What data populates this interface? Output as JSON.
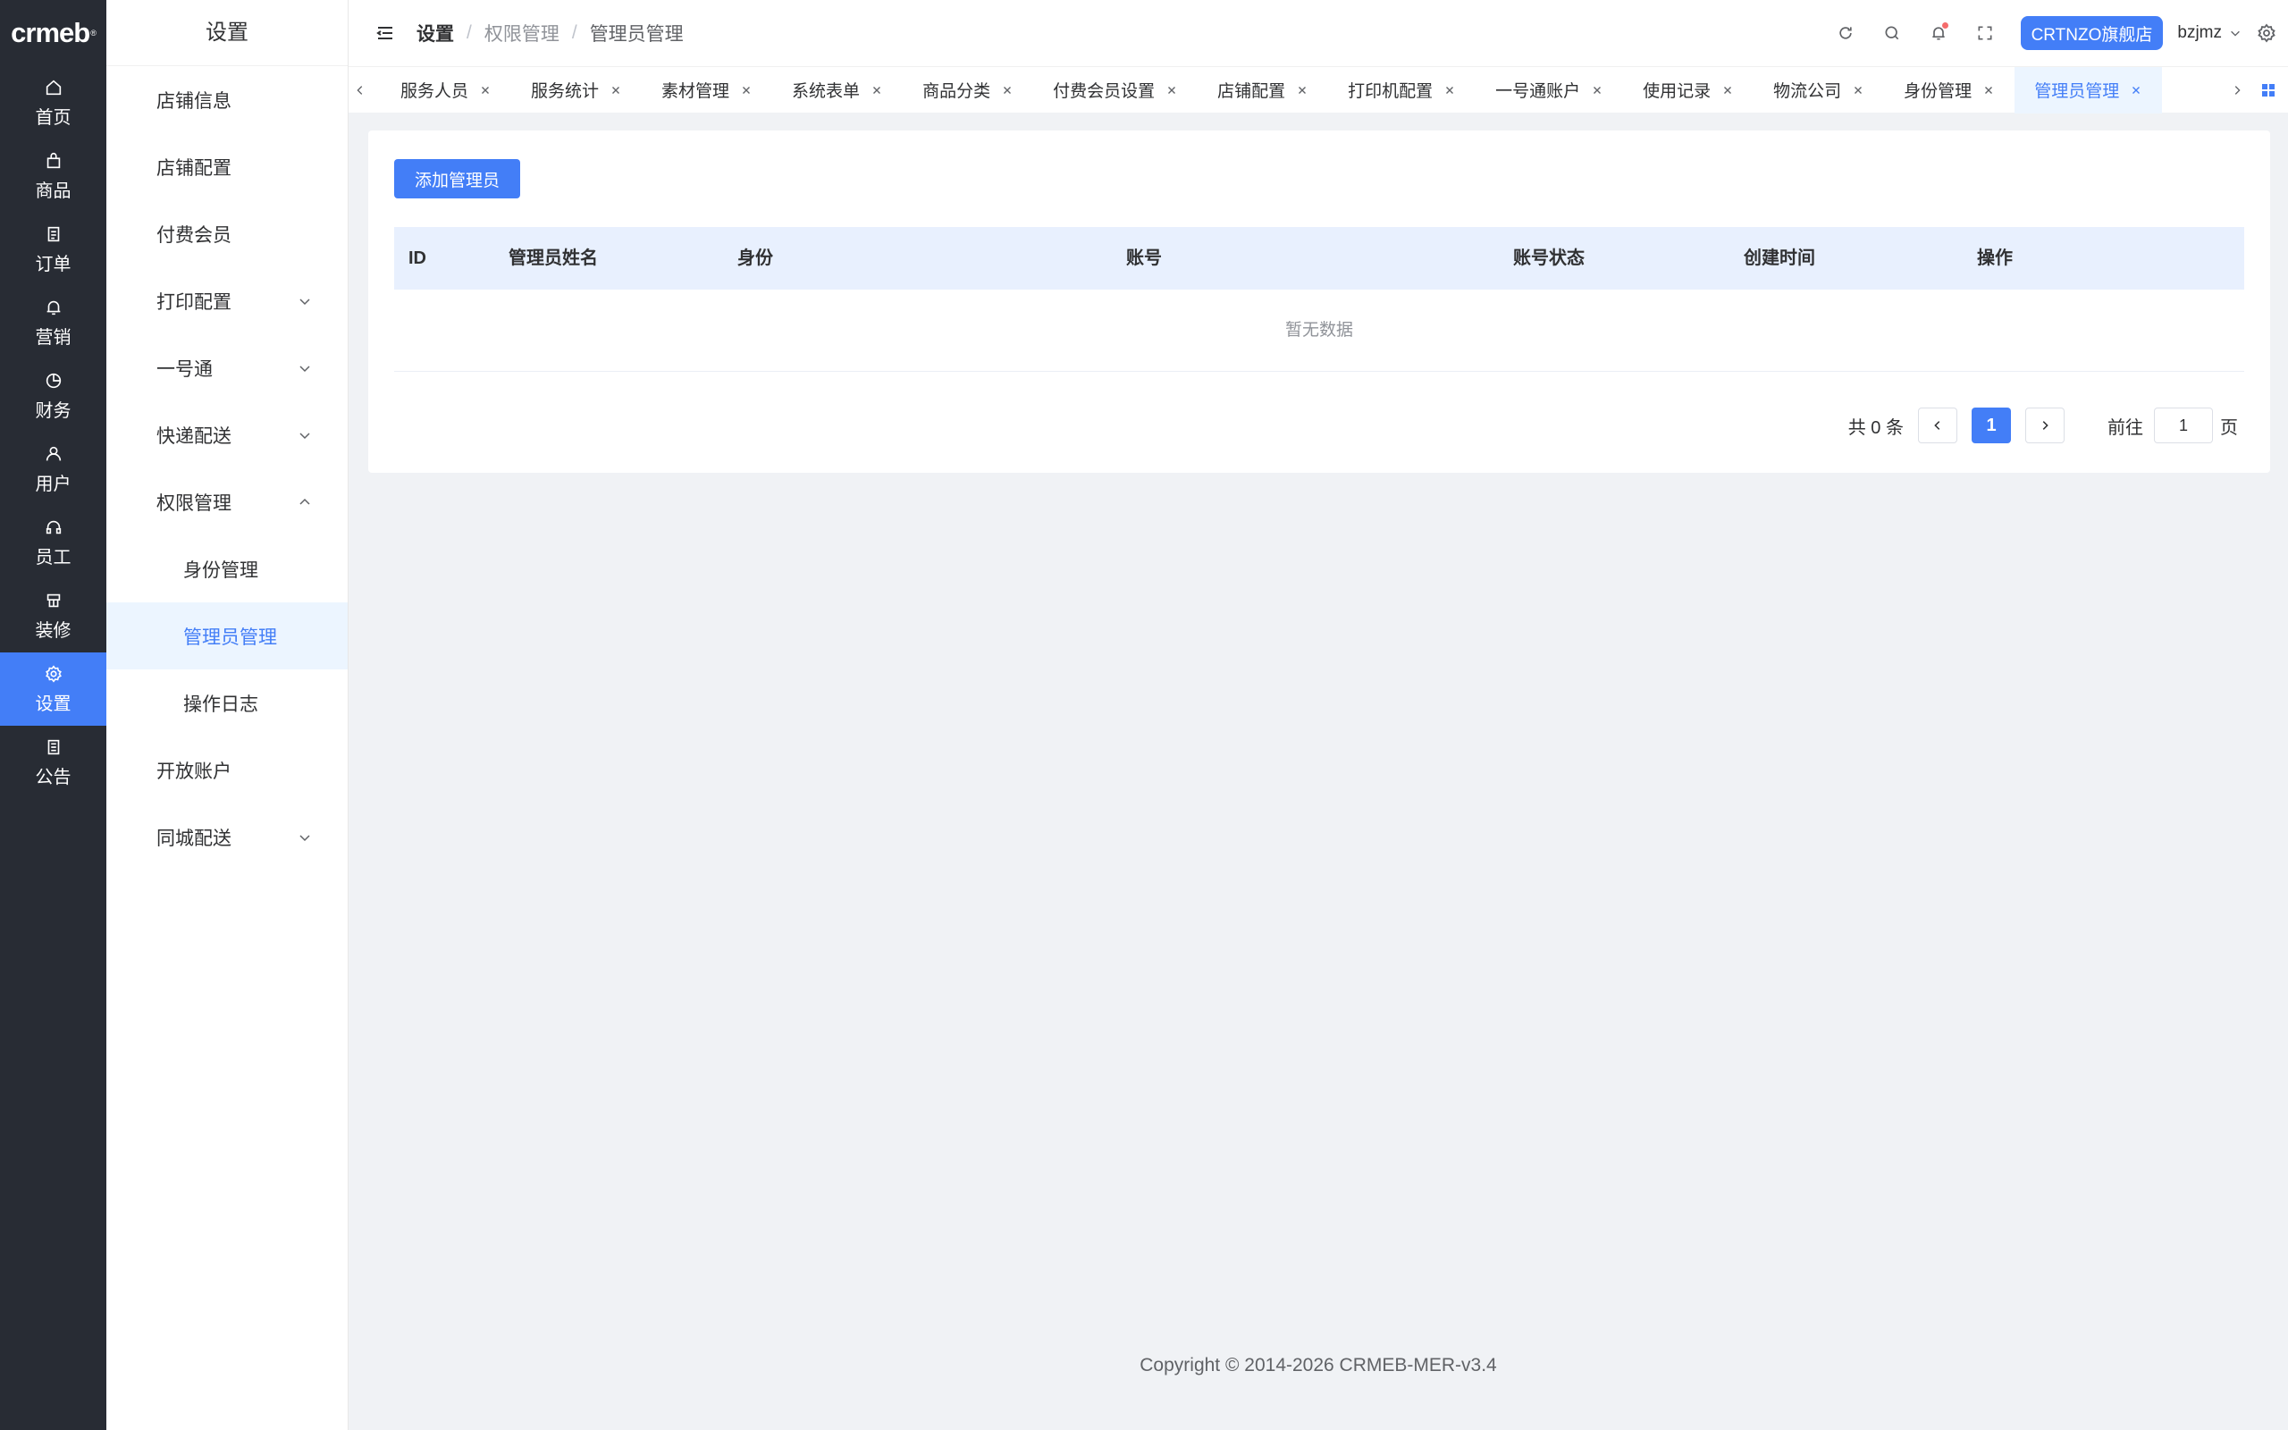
{
  "brand": {
    "logo_text": "crmeb",
    "logo_mark": "®"
  },
  "rail": [
    {
      "label": "首页",
      "icon": "home-icon"
    },
    {
      "label": "商品",
      "icon": "bag-icon"
    },
    {
      "label": "订单",
      "icon": "order-icon"
    },
    {
      "label": "营销",
      "icon": "bell-icon"
    },
    {
      "label": "财务",
      "icon": "pie-icon"
    },
    {
      "label": "用户",
      "icon": "user-icon"
    },
    {
      "label": "员工",
      "icon": "headset-icon"
    },
    {
      "label": "装修",
      "icon": "decorate-icon"
    },
    {
      "label": "设置",
      "icon": "settings-icon",
      "active": true
    },
    {
      "label": "公告",
      "icon": "notice-icon"
    }
  ],
  "submenu": {
    "title": "设置",
    "items": [
      {
        "label": "店铺信息"
      },
      {
        "label": "店铺配置"
      },
      {
        "label": "付费会员"
      },
      {
        "label": "打印配置",
        "expandable": true
      },
      {
        "label": "一号通",
        "expandable": true
      },
      {
        "label": "快递配送",
        "expandable": true
      },
      {
        "label": "权限管理",
        "expanded": true
      },
      {
        "label": "身份管理",
        "child": true
      },
      {
        "label": "管理员管理",
        "child": true,
        "active": true
      },
      {
        "label": "操作日志",
        "child": true
      },
      {
        "label": "开放账户"
      },
      {
        "label": "同城配送",
        "expandable": true
      }
    ]
  },
  "header": {
    "breadcrumb": [
      "设置",
      "权限管理",
      "管理员管理"
    ],
    "breadcrumb_sep": "/",
    "store_button": "CRTNZO旗舰店",
    "username": "bzjmz"
  },
  "tabs": [
    {
      "label": "服务人员"
    },
    {
      "label": "服务统计"
    },
    {
      "label": "素材管理"
    },
    {
      "label": "系统表单"
    },
    {
      "label": "商品分类"
    },
    {
      "label": "付费会员设置"
    },
    {
      "label": "店铺配置"
    },
    {
      "label": "打印机配置"
    },
    {
      "label": "一号通账户"
    },
    {
      "label": "使用记录"
    },
    {
      "label": "物流公司"
    },
    {
      "label": "身份管理"
    },
    {
      "label": "管理员管理",
      "active": true
    }
  ],
  "main": {
    "add_button": "添加管理员",
    "columns": [
      "ID",
      "管理员姓名",
      "身份",
      "账号",
      "账号状态",
      "创建时间",
      "操作"
    ],
    "empty_text": "暂无数据",
    "pagination": {
      "total_text": "共 0 条",
      "current_page": "1",
      "goto_label": "前往",
      "goto_value": "1",
      "page_suffix": "页"
    }
  },
  "footer": {
    "copyright": "Copyright © 2014-2026 CRMEB-MER-v3.4"
  },
  "colors": {
    "primary": "#437ef7",
    "rail_bg": "#282c34",
    "page_bg": "#f0f2f5",
    "table_head_bg": "#e8f0fe"
  }
}
